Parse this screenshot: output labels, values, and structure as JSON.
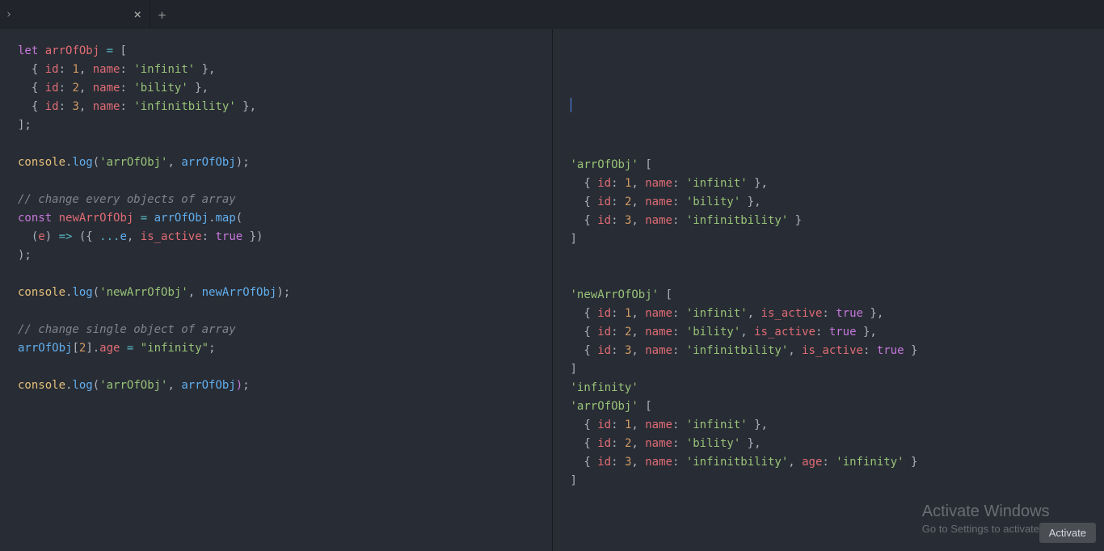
{
  "tabbar": {
    "close_glyph": "×",
    "new_tab_glyph": "+",
    "chevron_glyph": "›"
  },
  "activate": {
    "title": "Activate Windows",
    "subtitle": "Go to Settings to activate Windows.",
    "button": "Activate"
  },
  "editor": {
    "code_tokens": [
      [
        [
          "kw",
          "let"
        ],
        [
          "punc",
          " "
        ],
        [
          "def",
          "arrOfObj"
        ],
        [
          "punc",
          " "
        ],
        [
          "op",
          "="
        ],
        [
          "punc",
          " ["
        ]
      ],
      [
        [
          "punc",
          "  { "
        ],
        [
          "prop",
          "id"
        ],
        [
          "punc",
          ": "
        ],
        [
          "num",
          "1"
        ],
        [
          "punc",
          ", "
        ],
        [
          "prop",
          "name"
        ],
        [
          "punc",
          ": "
        ],
        [
          "str",
          "'infinit'"
        ],
        [
          "punc",
          " },"
        ]
      ],
      [
        [
          "punc",
          "  { "
        ],
        [
          "prop",
          "id"
        ],
        [
          "punc",
          ": "
        ],
        [
          "num",
          "2"
        ],
        [
          "punc",
          ", "
        ],
        [
          "prop",
          "name"
        ],
        [
          "punc",
          ": "
        ],
        [
          "str",
          "'bility'"
        ],
        [
          "punc",
          " },"
        ]
      ],
      [
        [
          "punc",
          "  { "
        ],
        [
          "prop",
          "id"
        ],
        [
          "punc",
          ": "
        ],
        [
          "num",
          "3"
        ],
        [
          "punc",
          ", "
        ],
        [
          "prop",
          "name"
        ],
        [
          "punc",
          ": "
        ],
        [
          "str",
          "'infinitbility'"
        ],
        [
          "punc",
          " },"
        ]
      ],
      [
        [
          "punc",
          "];"
        ]
      ],
      [],
      [
        [
          "obj",
          "console"
        ],
        [
          "dot",
          "."
        ],
        [
          "method",
          "log"
        ],
        [
          "punc",
          "("
        ],
        [
          "str",
          "'arrOfObj'"
        ],
        [
          "punc",
          ", "
        ],
        [
          "var",
          "arrOfObj"
        ],
        [
          "punc",
          ");"
        ]
      ],
      [],
      [
        [
          "comment",
          "// change every objects of array"
        ]
      ],
      [
        [
          "kw",
          "const"
        ],
        [
          "punc",
          " "
        ],
        [
          "def",
          "newArrOfObj"
        ],
        [
          "punc",
          " "
        ],
        [
          "op",
          "="
        ],
        [
          "punc",
          " "
        ],
        [
          "var",
          "arrOfObj"
        ],
        [
          "dot",
          "."
        ],
        [
          "method",
          "map"
        ],
        [
          "punc",
          "("
        ]
      ],
      [
        [
          "punc",
          "  ("
        ],
        [
          "def",
          "e"
        ],
        [
          "punc",
          ") "
        ],
        [
          "op",
          "=>"
        ],
        [
          "punc",
          " ({ "
        ],
        [
          "op",
          "..."
        ],
        [
          "var",
          "e"
        ],
        [
          "punc",
          ", "
        ],
        [
          "prop",
          "is_active"
        ],
        [
          "punc",
          ": "
        ],
        [
          "kw",
          "true"
        ],
        [
          "punc",
          " })"
        ]
      ],
      [
        [
          "punc",
          ");"
        ]
      ],
      [],
      [
        [
          "obj",
          "console"
        ],
        [
          "dot",
          "."
        ],
        [
          "method",
          "log"
        ],
        [
          "punc",
          "("
        ],
        [
          "str",
          "'newArrOfObj'"
        ],
        [
          "punc",
          ", "
        ],
        [
          "var",
          "newArrOfObj"
        ],
        [
          "punc",
          ");"
        ]
      ],
      [],
      [
        [
          "comment",
          "// change single object of array"
        ]
      ],
      [
        [
          "var",
          "arrOfObj"
        ],
        [
          "punc",
          "["
        ],
        [
          "num",
          "2"
        ],
        [
          "punc",
          "]."
        ],
        [
          "prop",
          "age"
        ],
        [
          "punc",
          " "
        ],
        [
          "op",
          "="
        ],
        [
          "punc",
          " "
        ],
        [
          "str",
          "\"infinity\""
        ],
        [
          "punc",
          ";"
        ]
      ],
      [],
      [
        [
          "obj",
          "console"
        ],
        [
          "dot",
          "."
        ],
        [
          "method",
          "log"
        ],
        [
          "punc",
          "("
        ],
        [
          "str",
          "'arrOfObj'"
        ],
        [
          "punc",
          ", "
        ],
        [
          "var",
          "arrOfObj"
        ],
        [
          "bracket-hi",
          ")"
        ],
        [
          "punc",
          ";"
        ]
      ]
    ]
  },
  "console": {
    "output_tokens": [
      [],
      [],
      [],
      [],
      [],
      [],
      [
        [
          "str",
          "'arrOfObj'"
        ],
        [
          "punc",
          " ["
        ]
      ],
      [
        [
          "punc",
          "  { "
        ],
        [
          "prop",
          "id"
        ],
        [
          "punc",
          ": "
        ],
        [
          "num",
          "1"
        ],
        [
          "punc",
          ", "
        ],
        [
          "prop",
          "name"
        ],
        [
          "punc",
          ": "
        ],
        [
          "str",
          "'infinit'"
        ],
        [
          "punc",
          " },"
        ]
      ],
      [
        [
          "punc",
          "  { "
        ],
        [
          "prop",
          "id"
        ],
        [
          "punc",
          ": "
        ],
        [
          "num",
          "2"
        ],
        [
          "punc",
          ", "
        ],
        [
          "prop",
          "name"
        ],
        [
          "punc",
          ": "
        ],
        [
          "str",
          "'bility'"
        ],
        [
          "punc",
          " },"
        ]
      ],
      [
        [
          "punc",
          "  { "
        ],
        [
          "prop",
          "id"
        ],
        [
          "punc",
          ": "
        ],
        [
          "num",
          "3"
        ],
        [
          "punc",
          ", "
        ],
        [
          "prop",
          "name"
        ],
        [
          "punc",
          ": "
        ],
        [
          "str",
          "'infinitbility'"
        ],
        [
          "punc",
          " }"
        ]
      ],
      [
        [
          "punc",
          "]"
        ]
      ],
      [],
      [],
      [
        [
          "str",
          "'newArrOfObj'"
        ],
        [
          "punc",
          " ["
        ]
      ],
      [
        [
          "punc",
          "  { "
        ],
        [
          "prop",
          "id"
        ],
        [
          "punc",
          ": "
        ],
        [
          "num",
          "1"
        ],
        [
          "punc",
          ", "
        ],
        [
          "prop",
          "name"
        ],
        [
          "punc",
          ": "
        ],
        [
          "str",
          "'infinit'"
        ],
        [
          "punc",
          ", "
        ],
        [
          "prop",
          "is_active"
        ],
        [
          "punc",
          ": "
        ],
        [
          "kw",
          "true"
        ],
        [
          "punc",
          " },"
        ]
      ],
      [
        [
          "punc",
          "  { "
        ],
        [
          "prop",
          "id"
        ],
        [
          "punc",
          ": "
        ],
        [
          "num",
          "2"
        ],
        [
          "punc",
          ", "
        ],
        [
          "prop",
          "name"
        ],
        [
          "punc",
          ": "
        ],
        [
          "str",
          "'bility'"
        ],
        [
          "punc",
          ", "
        ],
        [
          "prop",
          "is_active"
        ],
        [
          "punc",
          ": "
        ],
        [
          "kw",
          "true"
        ],
        [
          "punc",
          " },"
        ]
      ],
      [
        [
          "punc",
          "  { "
        ],
        [
          "prop",
          "id"
        ],
        [
          "punc",
          ": "
        ],
        [
          "num",
          "3"
        ],
        [
          "punc",
          ", "
        ],
        [
          "prop",
          "name"
        ],
        [
          "punc",
          ": "
        ],
        [
          "str",
          "'infinitbility'"
        ],
        [
          "punc",
          ", "
        ],
        [
          "prop",
          "is_active"
        ],
        [
          "punc",
          ": "
        ],
        [
          "kw",
          "true"
        ],
        [
          "punc",
          " }"
        ]
      ],
      [
        [
          "punc",
          "]"
        ]
      ],
      [
        [
          "str",
          "'infinity'"
        ]
      ],
      [
        [
          "str",
          "'arrOfObj'"
        ],
        [
          "punc",
          " ["
        ]
      ],
      [
        [
          "punc",
          "  { "
        ],
        [
          "prop",
          "id"
        ],
        [
          "punc",
          ": "
        ],
        [
          "num",
          "1"
        ],
        [
          "punc",
          ", "
        ],
        [
          "prop",
          "name"
        ],
        [
          "punc",
          ": "
        ],
        [
          "str",
          "'infinit'"
        ],
        [
          "punc",
          " },"
        ]
      ],
      [
        [
          "punc",
          "  { "
        ],
        [
          "prop",
          "id"
        ],
        [
          "punc",
          ": "
        ],
        [
          "num",
          "2"
        ],
        [
          "punc",
          ", "
        ],
        [
          "prop",
          "name"
        ],
        [
          "punc",
          ": "
        ],
        [
          "str",
          "'bility'"
        ],
        [
          "punc",
          " },"
        ]
      ],
      [
        [
          "punc",
          "  { "
        ],
        [
          "prop",
          "id"
        ],
        [
          "punc",
          ": "
        ],
        [
          "num",
          "3"
        ],
        [
          "punc",
          ", "
        ],
        [
          "prop",
          "name"
        ],
        [
          "punc",
          ": "
        ],
        [
          "str",
          "'infinitbility'"
        ],
        [
          "punc",
          ", "
        ],
        [
          "prop",
          "age"
        ],
        [
          "punc",
          ": "
        ],
        [
          "str",
          "'infinity'"
        ],
        [
          "punc",
          " }"
        ]
      ],
      [
        [
          "punc",
          "]"
        ]
      ]
    ]
  }
}
